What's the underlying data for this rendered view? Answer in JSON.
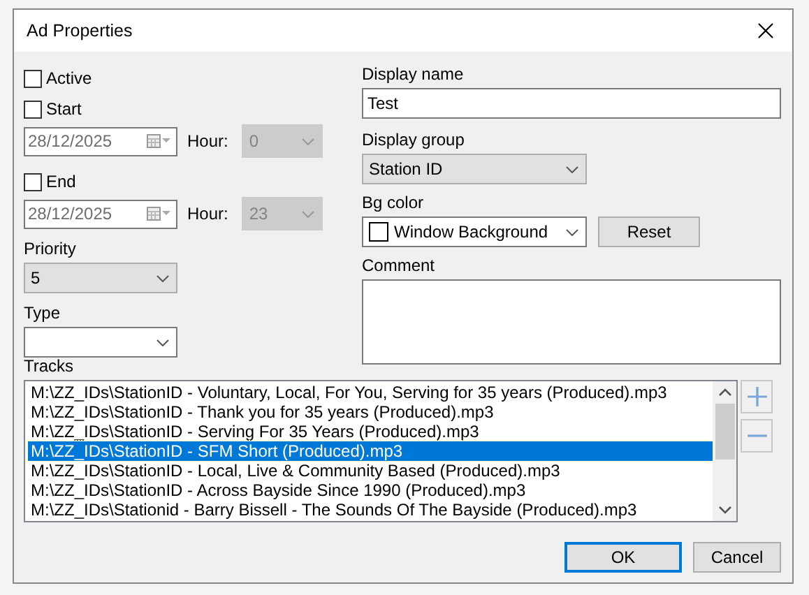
{
  "window": {
    "title": "Ad Properties"
  },
  "active": {
    "label": "Active",
    "checked": false
  },
  "start": {
    "label": "Start",
    "checked": false,
    "date": "28/12/2025",
    "hour_label": "Hour:",
    "hour": "0",
    "disabled": true
  },
  "end": {
    "label": "End",
    "checked": false,
    "date": "28/12/2025",
    "hour_label": "Hour:",
    "hour": "23",
    "disabled": true
  },
  "priority": {
    "label": "Priority",
    "value": "5"
  },
  "type": {
    "label": "Type"
  },
  "display_name": {
    "label": "Display name",
    "value": "Test"
  },
  "display_group": {
    "label": "Display group",
    "value": "Station ID"
  },
  "bg_color": {
    "label": "Bg color",
    "value": "Window Background",
    "button": "Reset"
  },
  "comment": {
    "label": "Comment"
  },
  "tracks": {
    "label": "Tracks",
    "items": [
      {
        "text": "M:\\ZZ_IDs\\StationID - Voluntary, Local, For You, Serving for 35 years (Produced).mp3",
        "selected": false
      },
      {
        "text": "M:\\ZZ_IDs\\StationID - Thank you for 35 years (Produced).mp3",
        "selected": false
      },
      {
        "text": "M:\\ZZ_IDs\\StationID - Serving For 35 Years (Produced).mp3",
        "selected": false
      },
      {
        "text": "M:\\ZZ_IDs\\StationID - SFM Short (Produced).mp3",
        "selected": true
      },
      {
        "text": "M:\\ZZ_IDs\\StationID - Local, Live & Community Based (Produced).mp3",
        "selected": false
      },
      {
        "text": "M:\\ZZ_IDs\\StationID - Across Bayside Since 1990 (Produced).mp3",
        "selected": false
      },
      {
        "text": "M:\\ZZ_IDs\\Stationid - Barry Bissell - The Sounds Of The Bayside (Produced).mp3",
        "selected": false
      }
    ]
  },
  "buttons": [
    {
      "label": "OK",
      "default": true
    },
    {
      "label": "Cancel",
      "default": false
    }
  ]
}
